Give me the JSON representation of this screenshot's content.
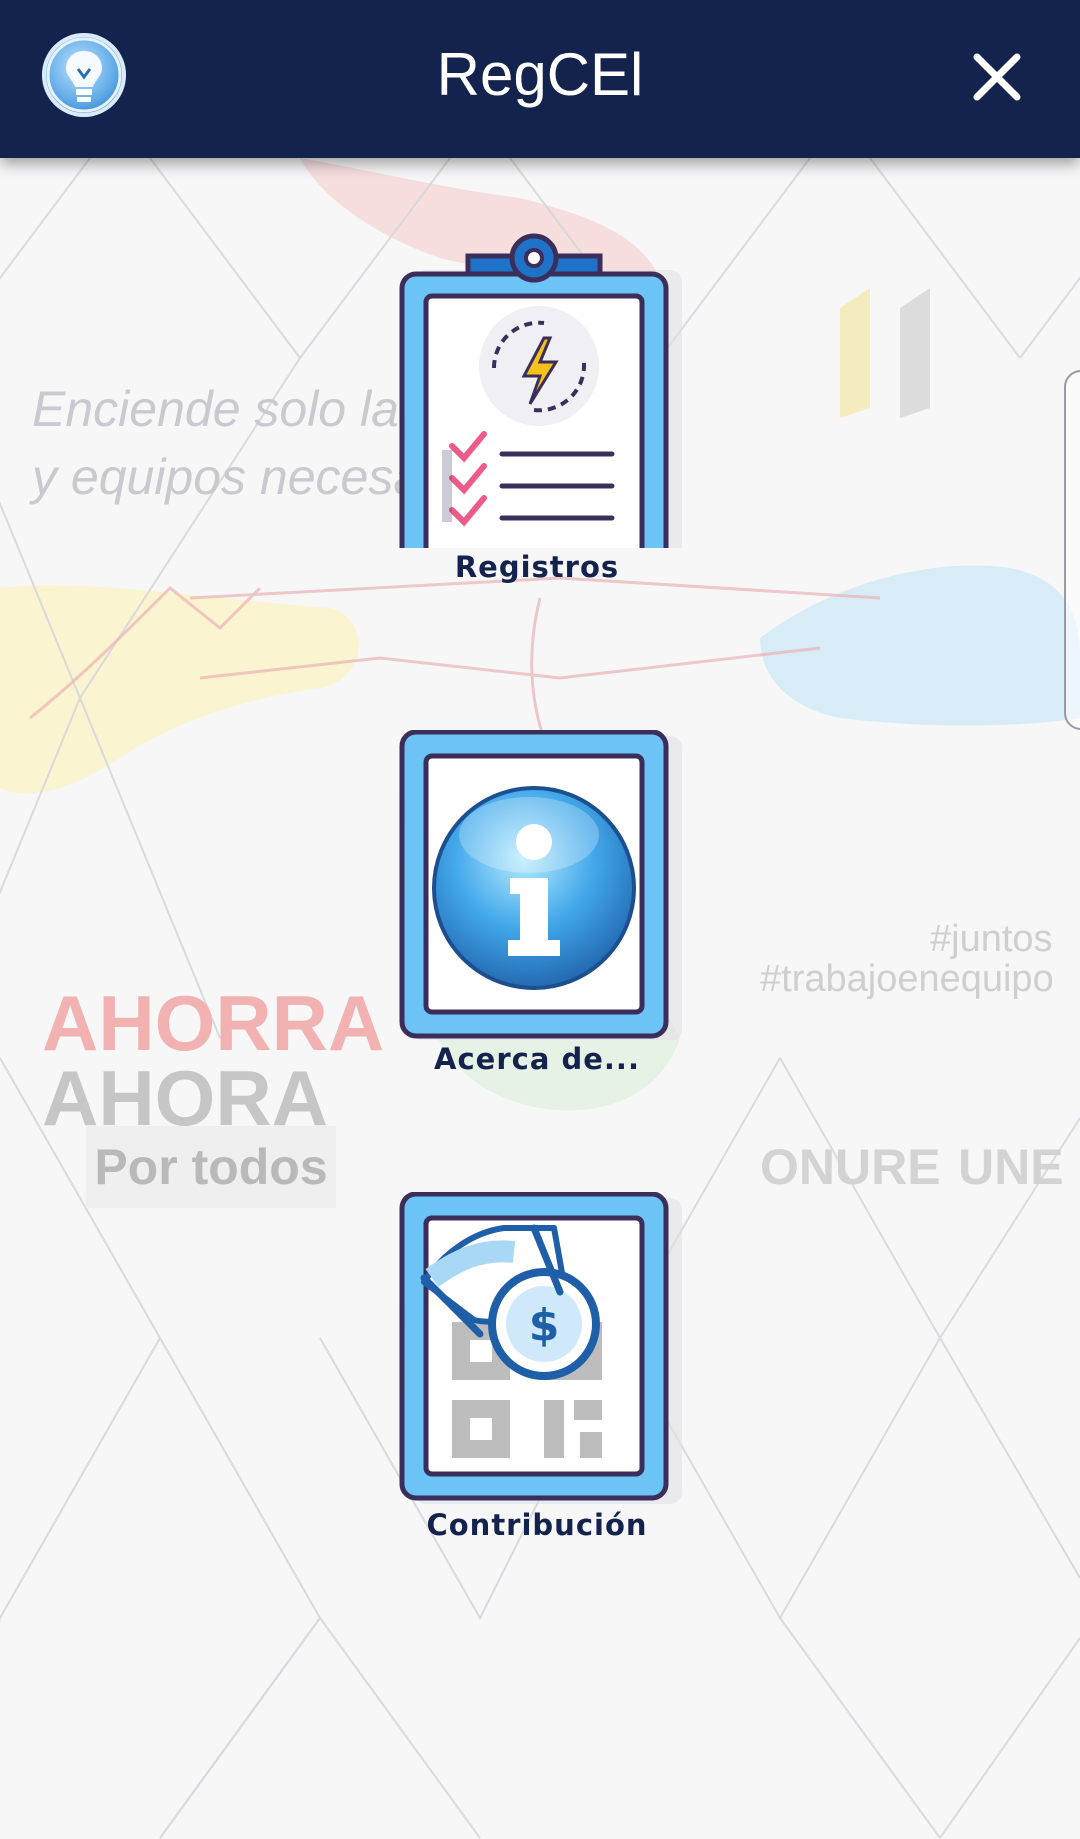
{
  "appbar": {
    "title": "RegCEl",
    "logo_icon": "lightbulb-icon",
    "close_icon": "close-icon",
    "background": "#14234d"
  },
  "background": {
    "slogan_line1": "Enciende solo las luc",
    "slogan_line2": "y equipos necesarios",
    "ahorra": "AHORRA",
    "ahora": "AHORA",
    "por_todos": "Por todos",
    "hashtag1": "#juntos",
    "hashtag2": "#trabajoenequipo",
    "logo_onure": "ONURE",
    "logo_une": "UNE"
  },
  "menu": {
    "items": [
      {
        "label": "Registros",
        "icon": "clipboard-energy-icon"
      },
      {
        "label": "Acerca de...",
        "icon": "info-icon"
      },
      {
        "label": "Contribución",
        "icon": "qr-payment-icon"
      }
    ]
  },
  "colors": {
    "accent": "#14234d",
    "tile_blue": "#6cc3f5",
    "tile_outline": "#3b2e5a"
  }
}
